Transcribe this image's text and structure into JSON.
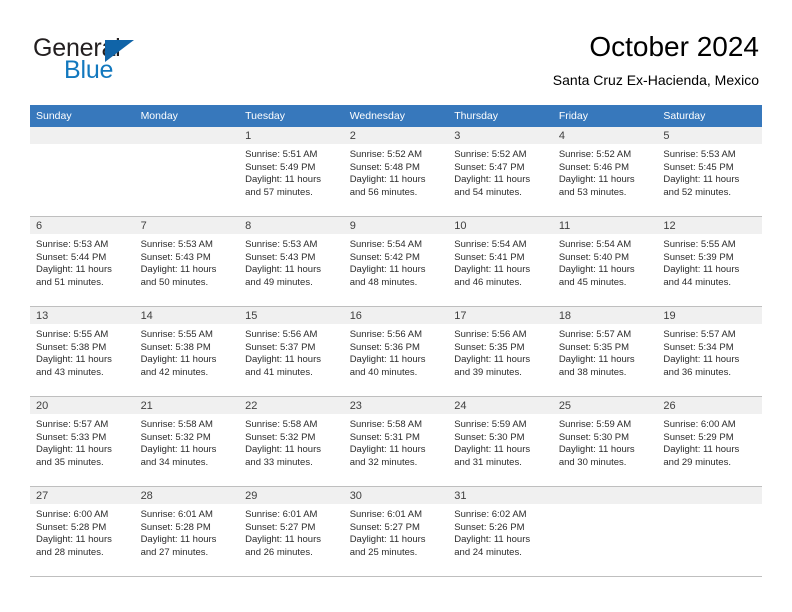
{
  "brand": {
    "name_part1": "General",
    "name_part2": "Blue",
    "triangle_color": "#1064a8",
    "blue_text_color": "#1278be"
  },
  "header": {
    "title": "October 2024",
    "subtitle": "Santa Cruz Ex-Hacienda, Mexico"
  },
  "theme": {
    "header_row_bg": "#3778bc",
    "header_row_text": "#ffffff",
    "daynum_bar_bg": "#f0f0f0",
    "cell_border": "#bfbfbf"
  },
  "weekday_headers": [
    "Sunday",
    "Monday",
    "Tuesday",
    "Wednesday",
    "Thursday",
    "Friday",
    "Saturday"
  ],
  "weeks": [
    [
      {
        "day": "",
        "empty": true,
        "sunrise": "",
        "sunset": "",
        "daylight_line1": "",
        "daylight_line2": ""
      },
      {
        "day": "",
        "empty": true,
        "sunrise": "",
        "sunset": "",
        "daylight_line1": "",
        "daylight_line2": ""
      },
      {
        "day": "1",
        "empty": false,
        "sunrise": "Sunrise: 5:51 AM",
        "sunset": "Sunset: 5:49 PM",
        "daylight_line1": "Daylight: 11 hours",
        "daylight_line2": "and 57 minutes."
      },
      {
        "day": "2",
        "empty": false,
        "sunrise": "Sunrise: 5:52 AM",
        "sunset": "Sunset: 5:48 PM",
        "daylight_line1": "Daylight: 11 hours",
        "daylight_line2": "and 56 minutes."
      },
      {
        "day": "3",
        "empty": false,
        "sunrise": "Sunrise: 5:52 AM",
        "sunset": "Sunset: 5:47 PM",
        "daylight_line1": "Daylight: 11 hours",
        "daylight_line2": "and 54 minutes."
      },
      {
        "day": "4",
        "empty": false,
        "sunrise": "Sunrise: 5:52 AM",
        "sunset": "Sunset: 5:46 PM",
        "daylight_line1": "Daylight: 11 hours",
        "daylight_line2": "and 53 minutes."
      },
      {
        "day": "5",
        "empty": false,
        "sunrise": "Sunrise: 5:53 AM",
        "sunset": "Sunset: 5:45 PM",
        "daylight_line1": "Daylight: 11 hours",
        "daylight_line2": "and 52 minutes."
      }
    ],
    [
      {
        "day": "6",
        "empty": false,
        "sunrise": "Sunrise: 5:53 AM",
        "sunset": "Sunset: 5:44 PM",
        "daylight_line1": "Daylight: 11 hours",
        "daylight_line2": "and 51 minutes."
      },
      {
        "day": "7",
        "empty": false,
        "sunrise": "Sunrise: 5:53 AM",
        "sunset": "Sunset: 5:43 PM",
        "daylight_line1": "Daylight: 11 hours",
        "daylight_line2": "and 50 minutes."
      },
      {
        "day": "8",
        "empty": false,
        "sunrise": "Sunrise: 5:53 AM",
        "sunset": "Sunset: 5:43 PM",
        "daylight_line1": "Daylight: 11 hours",
        "daylight_line2": "and 49 minutes."
      },
      {
        "day": "9",
        "empty": false,
        "sunrise": "Sunrise: 5:54 AM",
        "sunset": "Sunset: 5:42 PM",
        "daylight_line1": "Daylight: 11 hours",
        "daylight_line2": "and 48 minutes."
      },
      {
        "day": "10",
        "empty": false,
        "sunrise": "Sunrise: 5:54 AM",
        "sunset": "Sunset: 5:41 PM",
        "daylight_line1": "Daylight: 11 hours",
        "daylight_line2": "and 46 minutes."
      },
      {
        "day": "11",
        "empty": false,
        "sunrise": "Sunrise: 5:54 AM",
        "sunset": "Sunset: 5:40 PM",
        "daylight_line1": "Daylight: 11 hours",
        "daylight_line2": "and 45 minutes."
      },
      {
        "day": "12",
        "empty": false,
        "sunrise": "Sunrise: 5:55 AM",
        "sunset": "Sunset: 5:39 PM",
        "daylight_line1": "Daylight: 11 hours",
        "daylight_line2": "and 44 minutes."
      }
    ],
    [
      {
        "day": "13",
        "empty": false,
        "sunrise": "Sunrise: 5:55 AM",
        "sunset": "Sunset: 5:38 PM",
        "daylight_line1": "Daylight: 11 hours",
        "daylight_line2": "and 43 minutes."
      },
      {
        "day": "14",
        "empty": false,
        "sunrise": "Sunrise: 5:55 AM",
        "sunset": "Sunset: 5:38 PM",
        "daylight_line1": "Daylight: 11 hours",
        "daylight_line2": "and 42 minutes."
      },
      {
        "day": "15",
        "empty": false,
        "sunrise": "Sunrise: 5:56 AM",
        "sunset": "Sunset: 5:37 PM",
        "daylight_line1": "Daylight: 11 hours",
        "daylight_line2": "and 41 minutes."
      },
      {
        "day": "16",
        "empty": false,
        "sunrise": "Sunrise: 5:56 AM",
        "sunset": "Sunset: 5:36 PM",
        "daylight_line1": "Daylight: 11 hours",
        "daylight_line2": "and 40 minutes."
      },
      {
        "day": "17",
        "empty": false,
        "sunrise": "Sunrise: 5:56 AM",
        "sunset": "Sunset: 5:35 PM",
        "daylight_line1": "Daylight: 11 hours",
        "daylight_line2": "and 39 minutes."
      },
      {
        "day": "18",
        "empty": false,
        "sunrise": "Sunrise: 5:57 AM",
        "sunset": "Sunset: 5:35 PM",
        "daylight_line1": "Daylight: 11 hours",
        "daylight_line2": "and 38 minutes."
      },
      {
        "day": "19",
        "empty": false,
        "sunrise": "Sunrise: 5:57 AM",
        "sunset": "Sunset: 5:34 PM",
        "daylight_line1": "Daylight: 11 hours",
        "daylight_line2": "and 36 minutes."
      }
    ],
    [
      {
        "day": "20",
        "empty": false,
        "sunrise": "Sunrise: 5:57 AM",
        "sunset": "Sunset: 5:33 PM",
        "daylight_line1": "Daylight: 11 hours",
        "daylight_line2": "and 35 minutes."
      },
      {
        "day": "21",
        "empty": false,
        "sunrise": "Sunrise: 5:58 AM",
        "sunset": "Sunset: 5:32 PM",
        "daylight_line1": "Daylight: 11 hours",
        "daylight_line2": "and 34 minutes."
      },
      {
        "day": "22",
        "empty": false,
        "sunrise": "Sunrise: 5:58 AM",
        "sunset": "Sunset: 5:32 PM",
        "daylight_line1": "Daylight: 11 hours",
        "daylight_line2": "and 33 minutes."
      },
      {
        "day": "23",
        "empty": false,
        "sunrise": "Sunrise: 5:58 AM",
        "sunset": "Sunset: 5:31 PM",
        "daylight_line1": "Daylight: 11 hours",
        "daylight_line2": "and 32 minutes."
      },
      {
        "day": "24",
        "empty": false,
        "sunrise": "Sunrise: 5:59 AM",
        "sunset": "Sunset: 5:30 PM",
        "daylight_line1": "Daylight: 11 hours",
        "daylight_line2": "and 31 minutes."
      },
      {
        "day": "25",
        "empty": false,
        "sunrise": "Sunrise: 5:59 AM",
        "sunset": "Sunset: 5:30 PM",
        "daylight_line1": "Daylight: 11 hours",
        "daylight_line2": "and 30 minutes."
      },
      {
        "day": "26",
        "empty": false,
        "sunrise": "Sunrise: 6:00 AM",
        "sunset": "Sunset: 5:29 PM",
        "daylight_line1": "Daylight: 11 hours",
        "daylight_line2": "and 29 minutes."
      }
    ],
    [
      {
        "day": "27",
        "empty": false,
        "sunrise": "Sunrise: 6:00 AM",
        "sunset": "Sunset: 5:28 PM",
        "daylight_line1": "Daylight: 11 hours",
        "daylight_line2": "and 28 minutes."
      },
      {
        "day": "28",
        "empty": false,
        "sunrise": "Sunrise: 6:01 AM",
        "sunset": "Sunset: 5:28 PM",
        "daylight_line1": "Daylight: 11 hours",
        "daylight_line2": "and 27 minutes."
      },
      {
        "day": "29",
        "empty": false,
        "sunrise": "Sunrise: 6:01 AM",
        "sunset": "Sunset: 5:27 PM",
        "daylight_line1": "Daylight: 11 hours",
        "daylight_line2": "and 26 minutes."
      },
      {
        "day": "30",
        "empty": false,
        "sunrise": "Sunrise: 6:01 AM",
        "sunset": "Sunset: 5:27 PM",
        "daylight_line1": "Daylight: 11 hours",
        "daylight_line2": "and 25 minutes."
      },
      {
        "day": "31",
        "empty": false,
        "sunrise": "Sunrise: 6:02 AM",
        "sunset": "Sunset: 5:26 PM",
        "daylight_line1": "Daylight: 11 hours",
        "daylight_line2": "and 24 minutes."
      },
      {
        "day": "",
        "empty": true,
        "sunrise": "",
        "sunset": "",
        "daylight_line1": "",
        "daylight_line2": ""
      },
      {
        "day": "",
        "empty": true,
        "sunrise": "",
        "sunset": "",
        "daylight_line1": "",
        "daylight_line2": ""
      }
    ]
  ]
}
